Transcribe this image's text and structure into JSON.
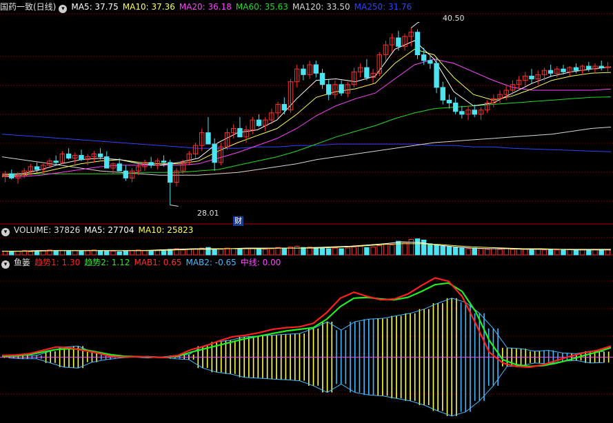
{
  "colors": {
    "bg": "#000000",
    "up": "#ff3030",
    "down": "#4de3f0",
    "grid": "#8b0000",
    "ma5": "#ffffff",
    "ma10": "#ffff55",
    "ma20": "#ff44ff",
    "ma60": "#22dd22",
    "ma120": "#d8d8d8",
    "ma250": "#2a45ff",
    "trend1": "#ff2020",
    "trend2": "#22ee22",
    "mab1": "#ffff44",
    "mab2": "#44bbff",
    "midline": "#ff44ff"
  },
  "price_legend": {
    "title": "国药一致(日线)",
    "ma5": "MA5: 37.75",
    "ma10": "MA10: 37.36",
    "ma20": "MA20: 36.18",
    "ma60": "MA60: 35.63",
    "ma120": "MA120: 33.50",
    "ma250": "MA250: 31.76"
  },
  "annotations": {
    "high": "40.50",
    "low": "28.01",
    "event": "财"
  },
  "volume_legend": {
    "volume": "VOLUME: 37826",
    "ma5": "MA5: 27704",
    "ma10": "MA10: 25823"
  },
  "indicator_legend": {
    "name": "鱼篓",
    "trend1": "趋势1: 1.30",
    "trend2": "趋势2: 1.12",
    "mab1": "MAB1: 0.65",
    "mab2": "MAB2: -0.65",
    "midline": "中线: 0.00"
  },
  "chart_data": [
    {
      "type": "candlestick",
      "name": "price",
      "candles": [
        [
          30.0,
          30.4,
          29.6,
          30.2
        ],
        [
          30.2,
          30.5,
          29.8,
          29.9
        ],
        [
          29.9,
          30.3,
          29.5,
          30.1
        ],
        [
          30.1,
          30.6,
          29.9,
          30.4
        ],
        [
          30.4,
          30.9,
          30.1,
          30.7
        ],
        [
          30.7,
          31.0,
          30.3,
          30.5
        ],
        [
          30.5,
          30.9,
          30.2,
          30.8
        ],
        [
          30.8,
          31.3,
          30.6,
          31.1
        ],
        [
          31.1,
          31.5,
          30.8,
          31.0
        ],
        [
          31.0,
          31.8,
          30.9,
          31.6
        ],
        [
          31.6,
          32.0,
          31.2,
          31.3
        ],
        [
          31.3,
          31.7,
          30.9,
          31.5
        ],
        [
          31.5,
          31.9,
          31.1,
          31.2
        ],
        [
          31.2,
          31.6,
          30.8,
          31.4
        ],
        [
          31.4,
          31.8,
          31.0,
          31.6
        ],
        [
          31.6,
          32.0,
          31.2,
          31.4
        ],
        [
          31.4,
          31.8,
          31.0,
          30.6
        ],
        [
          30.6,
          31.0,
          30.2,
          30.9
        ],
        [
          30.9,
          31.3,
          30.5,
          30.4
        ],
        [
          30.4,
          30.8,
          29.7,
          29.9
        ],
        [
          29.9,
          30.6,
          29.6,
          30.4
        ],
        [
          30.4,
          30.9,
          30.1,
          30.7
        ],
        [
          30.7,
          31.2,
          30.4,
          31.0
        ],
        [
          31.0,
          31.4,
          30.6,
          30.8
        ],
        [
          30.8,
          31.3,
          30.5,
          31.1
        ],
        [
          31.1,
          31.5,
          30.7,
          31.0
        ],
        [
          31.0,
          31.2,
          28.0,
          29.6
        ],
        [
          29.6,
          30.6,
          29.3,
          30.4
        ],
        [
          30.4,
          31.2,
          30.2,
          31.0
        ],
        [
          31.0,
          31.8,
          30.8,
          31.6
        ],
        [
          31.6,
          32.4,
          31.3,
          32.2
        ],
        [
          32.2,
          33.4,
          31.8,
          33.1
        ],
        [
          33.1,
          34.2,
          32.6,
          32.3
        ],
        [
          32.3,
          32.7,
          30.4,
          31.0
        ],
        [
          31.0,
          32.4,
          30.8,
          32.1
        ],
        [
          32.1,
          33.4,
          31.9,
          33.1
        ],
        [
          33.1,
          33.7,
          32.7,
          33.4
        ],
        [
          33.4,
          34.2,
          32.9,
          32.8
        ],
        [
          32.8,
          33.6,
          32.4,
          33.3
        ],
        [
          33.3,
          34.2,
          33.0,
          34.0
        ],
        [
          34.0,
          34.4,
          33.5,
          33.6
        ],
        [
          33.6,
          34.2,
          33.2,
          34.0
        ],
        [
          34.0,
          34.8,
          33.7,
          34.5
        ],
        [
          34.5,
          35.3,
          34.1,
          35.1
        ],
        [
          35.1,
          35.6,
          34.4,
          34.7
        ],
        [
          34.7,
          36.9,
          34.5,
          36.7
        ],
        [
          36.7,
          37.9,
          36.3,
          37.6
        ],
        [
          37.6,
          37.9,
          36.8,
          37.2
        ],
        [
          37.2,
          38.2,
          36.9,
          37.9
        ],
        [
          37.9,
          38.2,
          37.0,
          37.3
        ],
        [
          37.3,
          37.6,
          36.2,
          36.5
        ],
        [
          36.5,
          36.9,
          35.4,
          35.8
        ],
        [
          35.8,
          36.8,
          35.5,
          36.5
        ],
        [
          36.5,
          36.8,
          35.7,
          35.9
        ],
        [
          35.9,
          36.7,
          35.6,
          36.5
        ],
        [
          36.5,
          37.7,
          36.3,
          37.4
        ],
        [
          37.4,
          38.0,
          37.0,
          37.7
        ],
        [
          37.7,
          38.3,
          36.8,
          37.0
        ],
        [
          37.0,
          37.6,
          36.6,
          37.3
        ],
        [
          37.3,
          38.8,
          37.1,
          38.6
        ],
        [
          38.6,
          39.6,
          38.2,
          39.3
        ],
        [
          39.3,
          40.1,
          38.8,
          39.8
        ],
        [
          39.8,
          40.3,
          38.9,
          39.2
        ],
        [
          39.2,
          40.1,
          38.9,
          39.9
        ],
        [
          39.9,
          40.5,
          39.2,
          40.2
        ],
        [
          40.2,
          40.4,
          38.3,
          38.6
        ],
        [
          38.6,
          39.1,
          37.9,
          38.2
        ],
        [
          38.2,
          38.6,
          37.6,
          38.0
        ],
        [
          38.0,
          38.4,
          35.9,
          36.3
        ],
        [
          36.3,
          36.7,
          35.1,
          35.4
        ],
        [
          35.4,
          35.8,
          34.8,
          35.2
        ],
        [
          35.2,
          35.6,
          34.4,
          34.6
        ],
        [
          34.6,
          35.0,
          34.1,
          34.4
        ],
        [
          34.4,
          35.0,
          34.0,
          34.7
        ],
        [
          34.7,
          35.1,
          34.2,
          34.4
        ],
        [
          34.4,
          34.9,
          34.0,
          34.7
        ],
        [
          34.7,
          35.4,
          34.5,
          35.2
        ],
        [
          35.2,
          35.8,
          34.9,
          35.5
        ],
        [
          35.5,
          36.1,
          35.2,
          35.8
        ],
        [
          35.8,
          36.4,
          35.4,
          36.1
        ],
        [
          36.1,
          36.8,
          35.8,
          36.5
        ],
        [
          36.5,
          37.1,
          36.2,
          36.8
        ],
        [
          36.8,
          37.4,
          36.4,
          37.1
        ],
        [
          37.1,
          37.6,
          36.6,
          36.9
        ],
        [
          36.9,
          37.5,
          36.5,
          37.2
        ],
        [
          37.2,
          37.7,
          36.8,
          37.5
        ],
        [
          37.5,
          37.9,
          37.1,
          37.3
        ],
        [
          37.3,
          37.8,
          37.0,
          37.6
        ],
        [
          37.6,
          37.9,
          37.2,
          37.4
        ],
        [
          37.4,
          37.8,
          37.1,
          37.7
        ],
        [
          37.7,
          38.0,
          37.3,
          37.5
        ],
        [
          37.5,
          37.9,
          37.2,
          37.8
        ],
        [
          37.8,
          38.1,
          37.4,
          37.6
        ],
        [
          37.6,
          38.0,
          37.3,
          37.8
        ],
        [
          37.8,
          38.2,
          37.5,
          37.7
        ],
        [
          37.7,
          38.1,
          37.4,
          37.75
        ]
      ],
      "ma_lines": {
        "ma5": [
          30.1,
          30.2,
          30.5,
          30.9,
          31.2,
          31.3,
          31.2,
          30.9,
          30.8,
          31.0,
          31.3,
          32.4,
          33.1,
          33.3,
          34.0,
          35.5,
          36.8,
          36.9,
          36.7,
          37.1,
          39.0,
          39.6,
          38.3,
          36.0,
          35.0,
          35.2,
          35.9,
          36.6,
          37.1,
          37.4,
          37.6,
          37.75
        ],
        "ma10": [
          30.0,
          30.1,
          30.3,
          30.6,
          30.9,
          31.1,
          31.2,
          31.0,
          30.9,
          30.9,
          31.1,
          31.8,
          32.4,
          32.9,
          33.4,
          34.4,
          35.6,
          36.0,
          36.2,
          36.6,
          38.0,
          39.0,
          38.6,
          37.0,
          35.8,
          35.4,
          35.7,
          36.2,
          36.8,
          37.1,
          37.3,
          37.36
        ],
        "ma20": [
          30.0,
          30.0,
          30.1,
          30.3,
          30.5,
          30.7,
          30.8,
          30.8,
          30.8,
          30.8,
          30.9,
          31.3,
          31.7,
          32.2,
          32.7,
          33.4,
          34.3,
          35.0,
          35.5,
          35.9,
          36.9,
          37.9,
          38.3,
          38.0,
          37.4,
          36.8,
          36.3,
          36.1,
          36.1,
          36.1,
          36.1,
          36.18
        ],
        "ma60": [
          30.2,
          30.2,
          30.2,
          30.2,
          30.2,
          30.2,
          30.2,
          30.3,
          30.3,
          30.3,
          30.4,
          30.5,
          30.8,
          31.1,
          31.4,
          31.8,
          32.3,
          32.8,
          33.2,
          33.6,
          34.1,
          34.5,
          34.8,
          34.9,
          35.0,
          35.1,
          35.2,
          35.3,
          35.4,
          35.5,
          35.6,
          35.63
        ],
        "ma120": [
          31.4,
          31.2,
          31.0,
          30.8,
          30.6,
          30.4,
          30.3,
          30.2,
          30.1,
          30.1,
          30.1,
          30.2,
          30.3,
          30.5,
          30.7,
          30.9,
          31.2,
          31.4,
          31.6,
          31.8,
          32.0,
          32.2,
          32.4,
          32.5,
          32.6,
          32.7,
          32.8,
          32.9,
          33.0,
          33.2,
          33.4,
          33.5
        ],
        "ma250": [
          33.0,
          32.9,
          32.8,
          32.7,
          32.6,
          32.5,
          32.4,
          32.3,
          32.2,
          32.1,
          32.0,
          32.0,
          32.0,
          32.1,
          32.1,
          32.2,
          32.2,
          32.3,
          32.3,
          32.3,
          32.3,
          32.3,
          32.2,
          32.2,
          32.1,
          32.1,
          32.0,
          31.95,
          31.9,
          31.85,
          31.8,
          31.76
        ]
      },
      "ylim": [
        27.0,
        41.5
      ],
      "high_label": "40.50",
      "low_label": "28.01"
    },
    {
      "type": "bar",
      "name": "volume",
      "values": [
        6,
        5,
        6,
        7,
        5,
        6,
        7,
        8,
        6,
        7,
        6,
        7,
        6,
        7,
        8,
        7,
        6,
        6,
        5,
        6,
        7,
        8,
        7,
        6,
        7,
        6,
        9,
        10,
        8,
        9,
        10,
        11,
        12,
        10,
        9,
        11,
        10,
        9,
        10,
        11,
        10,
        9,
        10,
        12,
        11,
        13,
        14,
        12,
        13,
        12,
        11,
        10,
        11,
        10,
        11,
        13,
        14,
        12,
        13,
        15,
        18,
        16,
        22,
        20,
        25,
        26,
        24,
        18,
        16,
        14,
        13,
        12,
        11,
        10,
        11,
        10,
        9,
        10,
        9,
        10,
        9,
        10,
        9,
        8,
        9,
        8,
        9,
        8,
        8,
        9,
        8,
        8,
        8,
        9,
        8,
        8
      ],
      "ma5_line": [
        6,
        6,
        7,
        7,
        7,
        7,
        7,
        7,
        7,
        8,
        9,
        10,
        10,
        10,
        11,
        11,
        11,
        11,
        12,
        13,
        14,
        16,
        18,
        21,
        20,
        16,
        13,
        11,
        10,
        10,
        9,
        9,
        9,
        8,
        8,
        8
      ],
      "ma10_line": [
        6,
        6,
        6,
        7,
        7,
        7,
        7,
        7,
        7,
        7,
        8,
        9,
        9,
        10,
        10,
        10,
        11,
        11,
        11,
        12,
        13,
        15,
        17,
        18,
        18,
        17,
        15,
        13,
        12,
        11,
        10,
        10,
        9,
        9,
        9,
        9
      ],
      "ylim": [
        0,
        30
      ]
    },
    {
      "type": "line",
      "name": "fish-basket",
      "trend1": [
        0.2,
        0.25,
        0.4,
        0.8,
        1.2,
        1.1,
        0.8,
        0.5,
        0.1,
        0.0,
        0.05,
        0.0,
        -0.05,
        0.2,
        0.9,
        1.3,
        1.9,
        2.4,
        2.6,
        2.9,
        3.3,
        3.5,
        3.6,
        4.0,
        5.3,
        7.0,
        7.7,
        7.2,
        6.8,
        6.9,
        7.5,
        8.5,
        9.4,
        9.0,
        7.2,
        4.0,
        0.6,
        -0.7,
        -1.1,
        -1.2,
        -0.9,
        -0.4,
        0.1,
        0.5,
        0.8,
        1.3
      ],
      "trend2": [
        0.1,
        0.15,
        0.3,
        0.6,
        0.9,
        1.0,
        0.9,
        0.6,
        0.3,
        0.1,
        0.05,
        0.0,
        -0.05,
        0.1,
        0.6,
        1.0,
        1.4,
        1.8,
        2.2,
        2.5,
        2.8,
        3.1,
        3.3,
        3.5,
        4.5,
        6.0,
        7.0,
        7.1,
        6.9,
        6.8,
        7.1,
        7.8,
        8.6,
        8.8,
        7.8,
        5.4,
        2.0,
        -0.3,
        -0.9,
        -1.1,
        -1.0,
        -0.7,
        -0.3,
        0.2,
        0.6,
        1.12
      ],
      "mab": [
        0.1,
        0.2,
        -0.2,
        0.7,
        1.2,
        1.3,
        0.6,
        -0.3,
        -0.1,
        0.0,
        0.1,
        0.0,
        -0.2,
        0.3,
        1.3,
        1.8,
        2.0,
        2.4,
        2.5,
        2.6,
        2.7,
        2.8,
        3.4,
        4.2,
        -3.2,
        -4.2,
        -4.5,
        4.6,
        4.9,
        5.2,
        5.7,
        6.4,
        7.0,
        -6.5,
        -5.2,
        -3.4,
        1.1,
        1.0,
        0.7,
        -0.8,
        -0.5,
        0.4,
        0.7,
        0.65
      ],
      "ylim": [
        -7.5,
        10.5
      ]
    }
  ]
}
